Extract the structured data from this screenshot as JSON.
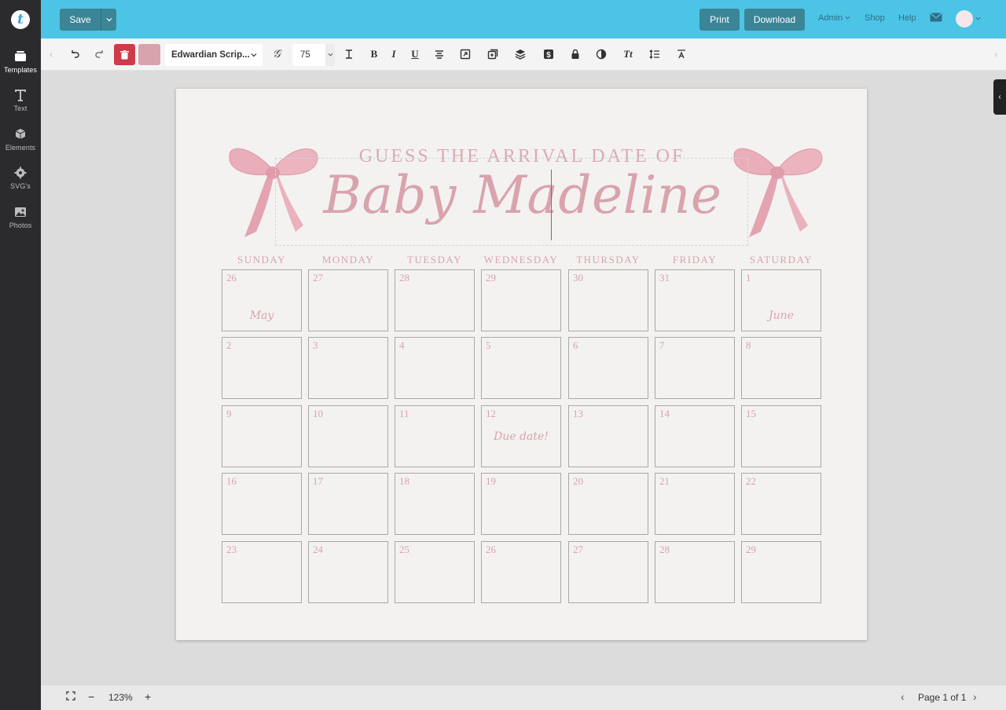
{
  "header": {
    "save_label": "Save",
    "print_label": "Print",
    "download_label": "Download",
    "nav": {
      "admin": "Admin",
      "shop": "Shop",
      "help": "Help"
    }
  },
  "sidebar": {
    "items": [
      {
        "label": "Templates",
        "icon": "templates-icon"
      },
      {
        "label": "Text",
        "icon": "text-icon"
      },
      {
        "label": "Elements",
        "icon": "elements-icon"
      },
      {
        "label": "SVG's",
        "icon": "gear-icon"
      },
      {
        "label": "Photos",
        "icon": "photos-icon"
      }
    ]
  },
  "toolbar": {
    "font_name": "Edwardian Scrip...",
    "font_size": "75",
    "bold": "B",
    "italic": "I",
    "underline": "U",
    "text_transform": "Tt",
    "color_swatch": "#d9a3ad"
  },
  "canvas": {
    "heading": "GUESS THE ARRIVAL DATE OF",
    "baby_name": "Baby Madeline",
    "weekdays": [
      "SUNDAY",
      "MONDAY",
      "TUESDAY",
      "WEDNESDAY",
      "THURSDAY",
      "FRIDAY",
      "SATURDAY"
    ],
    "weeks": [
      [
        "26",
        "27",
        "28",
        "29",
        "30",
        "31",
        "1"
      ],
      [
        "2",
        "3",
        "4",
        "5",
        "6",
        "7",
        "8"
      ],
      [
        "9",
        "10",
        "11",
        "12",
        "13",
        "14",
        "15"
      ],
      [
        "16",
        "17",
        "18",
        "19",
        "20",
        "21",
        "22"
      ],
      [
        "23",
        "24",
        "25",
        "26",
        "27",
        "28",
        "29"
      ]
    ],
    "notes": {
      "may": "May",
      "june": "June",
      "due": "Due date!"
    },
    "accent_color": "#d9a3ad"
  },
  "footer": {
    "zoom": "123%",
    "page_indicator": "Page 1 of 1"
  },
  "colors": {
    "header_bg": "#4cc4e6",
    "button_dark": "#3b8597",
    "delete_red": "#cf3a4a",
    "rail_bg": "#2b2b2e"
  }
}
